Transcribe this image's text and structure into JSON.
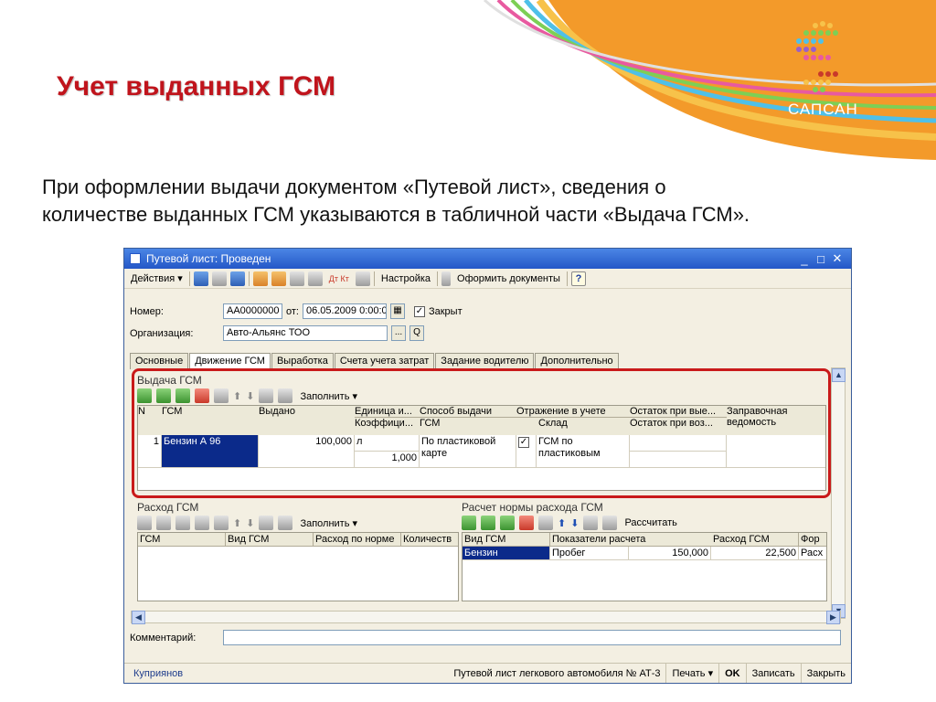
{
  "slide": {
    "title": "Учет выданных ГСМ",
    "logo_text": "САПСАН",
    "intro_line1": "При оформлении выдачи документом «Путевой лист», сведения о",
    "intro_line2": "количестве выданных ГСМ указываются в табличной части «Выдача ГСМ»."
  },
  "colors": {
    "title_red": "#c0141c",
    "frame_red": "#c91a1a",
    "window_blue": "#2457c7",
    "selection": "#0b2a8a"
  },
  "window": {
    "title": "Путевой лист: Проведен",
    "controls": [
      "_",
      "□",
      "✕"
    ]
  },
  "toolbar": {
    "actions": "Действия ▾",
    "settings": "Настройка",
    "make_documents": "Оформить документы",
    "help": "?",
    "dt_kt": "Дт Кт"
  },
  "header": {
    "number_label": "Номер:",
    "number_value": "АА0000000",
    "date_label": "от:",
    "date_value": "06.05.2009 0:00:0",
    "closed_label": "Закрыт",
    "org_label": "Организация:",
    "org_value": "Авто-Альянс ТОО",
    "dots": "...",
    "search": "Q"
  },
  "tabs": [
    "Основные",
    "Движение ГСМ",
    "Выработка",
    "Счета учета затрат",
    "Задание водителю",
    "Дополнительно"
  ],
  "issue": {
    "title": "Выдача ГСМ",
    "fill": "Заполнить ▾",
    "cols1": [
      "N",
      "ГСМ",
      "Выдано",
      "Единица и...",
      "Способ выдачи",
      "Отражение в учете",
      "Остаток при вые...",
      "Заправочная"
    ],
    "cols2": [
      "Коэффици...",
      "ГСМ",
      "Склад",
      "Остаток при воз...",
      "ведомость"
    ],
    "row": {
      "n": "1",
      "fuel": "Бензин А 96",
      "issued": "100,000",
      "unit": "л",
      "coef": "1,000",
      "method1": "По пластиковой",
      "method2": "карте",
      "check": "✓",
      "account1": "ГСМ по",
      "account2": "пластиковым"
    }
  },
  "consumption": {
    "title": "Расход ГСМ",
    "fill": "Заполнить ▾",
    "cols": [
      "ГСМ",
      "Вид ГСМ",
      "Расход по норме",
      "Количеств"
    ]
  },
  "norm": {
    "title": "Расчет нормы расхода ГСМ",
    "calc": "Рассчитать",
    "cols": [
      "Вид ГСМ",
      "Показатели расчета",
      "",
      "Расход ГСМ",
      "Фор"
    ],
    "row": [
      "Бензин",
      "Пробег",
      "150,000",
      "22,500",
      "Расх"
    ]
  },
  "comment_label": "Комментарий:",
  "status": {
    "user": "Куприянов",
    "form": "Путевой лист легкового автомобиля № АТ-3",
    "print": "Печать ▾",
    "ok": "OK",
    "save": "Записать",
    "close": "Закрыть"
  }
}
